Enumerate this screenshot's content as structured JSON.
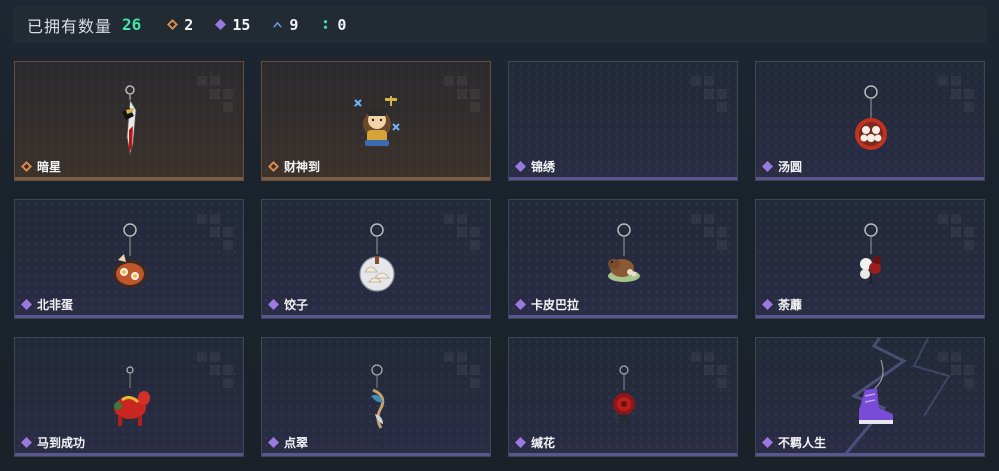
{
  "header": {
    "title": "已拥有数量",
    "total": "26",
    "stats": [
      {
        "icon": "orange-diamond-icon",
        "color": "#d98b4a",
        "value": "2"
      },
      {
        "icon": "purple-diamond-icon",
        "color": "#9a7ae0",
        "value": "15"
      },
      {
        "icon": "blue-chevron-icon",
        "color": "#6aa2e8",
        "value": "9"
      },
      {
        "icon": "teal-dots-icon",
        "color": "#3fd6b0",
        "value": "0"
      }
    ]
  },
  "cards": [
    {
      "name": "暗星",
      "rarity": "orange",
      "icon": "dagger-charm-icon"
    },
    {
      "name": "财神到",
      "rarity": "orange",
      "icon": "fortune-god-charm-icon"
    },
    {
      "name": "锦绣",
      "rarity": "purple",
      "icon": ""
    },
    {
      "name": "汤圆",
      "rarity": "purple",
      "icon": "tangyuan-bowl-charm-icon"
    },
    {
      "name": "北非蛋",
      "rarity": "purple",
      "icon": "shakshuka-pan-charm-icon"
    },
    {
      "name": "饺子",
      "rarity": "purple",
      "icon": "dumpling-plate-charm-icon"
    },
    {
      "name": "卡皮巴拉",
      "rarity": "purple",
      "icon": "capybara-charm-icon"
    },
    {
      "name": "荼蘼",
      "rarity": "purple",
      "icon": "flower-bouquet-charm-icon"
    },
    {
      "name": "马到成功",
      "rarity": "purple",
      "icon": "red-horse-charm-icon"
    },
    {
      "name": "点翠",
      "rarity": "purple",
      "icon": "phoenix-hairpin-charm-icon"
    },
    {
      "name": "缄花",
      "rarity": "purple",
      "icon": "red-rose-charm-icon"
    },
    {
      "name": "不羁人生",
      "rarity": "purple",
      "icon": "purple-sneaker-charm-icon"
    }
  ]
}
